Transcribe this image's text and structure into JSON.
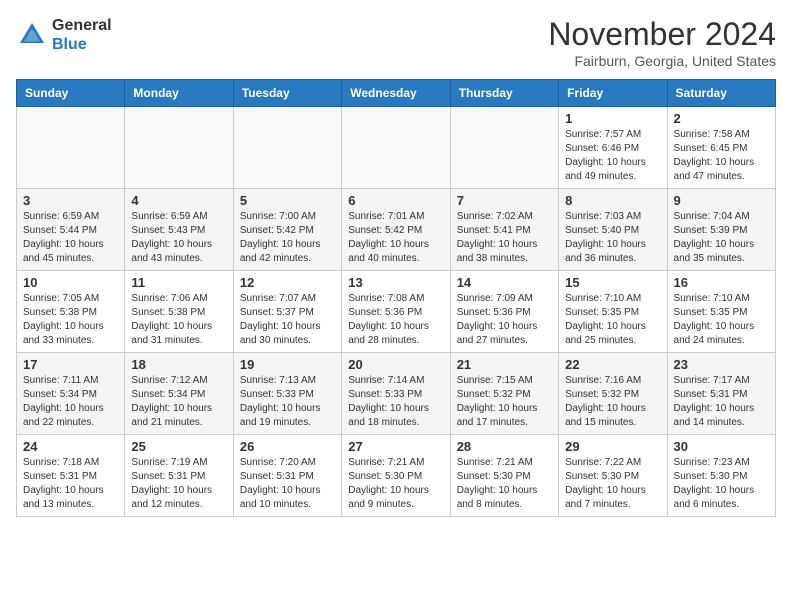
{
  "header": {
    "logo_line1": "General",
    "logo_line2": "Blue",
    "month_title": "November 2024",
    "location": "Fairburn, Georgia, United States"
  },
  "calendar": {
    "weekdays": [
      "Sunday",
      "Monday",
      "Tuesday",
      "Wednesday",
      "Thursday",
      "Friday",
      "Saturday"
    ],
    "weeks": [
      [
        {
          "day": "",
          "info": ""
        },
        {
          "day": "",
          "info": ""
        },
        {
          "day": "",
          "info": ""
        },
        {
          "day": "",
          "info": ""
        },
        {
          "day": "",
          "info": ""
        },
        {
          "day": "1",
          "info": "Sunrise: 7:57 AM\nSunset: 6:46 PM\nDaylight: 10 hours and 49 minutes."
        },
        {
          "day": "2",
          "info": "Sunrise: 7:58 AM\nSunset: 6:45 PM\nDaylight: 10 hours and 47 minutes."
        }
      ],
      [
        {
          "day": "3",
          "info": "Sunrise: 6:59 AM\nSunset: 5:44 PM\nDaylight: 10 hours and 45 minutes."
        },
        {
          "day": "4",
          "info": "Sunrise: 6:59 AM\nSunset: 5:43 PM\nDaylight: 10 hours and 43 minutes."
        },
        {
          "day": "5",
          "info": "Sunrise: 7:00 AM\nSunset: 5:42 PM\nDaylight: 10 hours and 42 minutes."
        },
        {
          "day": "6",
          "info": "Sunrise: 7:01 AM\nSunset: 5:42 PM\nDaylight: 10 hours and 40 minutes."
        },
        {
          "day": "7",
          "info": "Sunrise: 7:02 AM\nSunset: 5:41 PM\nDaylight: 10 hours and 38 minutes."
        },
        {
          "day": "8",
          "info": "Sunrise: 7:03 AM\nSunset: 5:40 PM\nDaylight: 10 hours and 36 minutes."
        },
        {
          "day": "9",
          "info": "Sunrise: 7:04 AM\nSunset: 5:39 PM\nDaylight: 10 hours and 35 minutes."
        }
      ],
      [
        {
          "day": "10",
          "info": "Sunrise: 7:05 AM\nSunset: 5:38 PM\nDaylight: 10 hours and 33 minutes."
        },
        {
          "day": "11",
          "info": "Sunrise: 7:06 AM\nSunset: 5:38 PM\nDaylight: 10 hours and 31 minutes."
        },
        {
          "day": "12",
          "info": "Sunrise: 7:07 AM\nSunset: 5:37 PM\nDaylight: 10 hours and 30 minutes."
        },
        {
          "day": "13",
          "info": "Sunrise: 7:08 AM\nSunset: 5:36 PM\nDaylight: 10 hours and 28 minutes."
        },
        {
          "day": "14",
          "info": "Sunrise: 7:09 AM\nSunset: 5:36 PM\nDaylight: 10 hours and 27 minutes."
        },
        {
          "day": "15",
          "info": "Sunrise: 7:10 AM\nSunset: 5:35 PM\nDaylight: 10 hours and 25 minutes."
        },
        {
          "day": "16",
          "info": "Sunrise: 7:10 AM\nSunset: 5:35 PM\nDaylight: 10 hours and 24 minutes."
        }
      ],
      [
        {
          "day": "17",
          "info": "Sunrise: 7:11 AM\nSunset: 5:34 PM\nDaylight: 10 hours and 22 minutes."
        },
        {
          "day": "18",
          "info": "Sunrise: 7:12 AM\nSunset: 5:34 PM\nDaylight: 10 hours and 21 minutes."
        },
        {
          "day": "19",
          "info": "Sunrise: 7:13 AM\nSunset: 5:33 PM\nDaylight: 10 hours and 19 minutes."
        },
        {
          "day": "20",
          "info": "Sunrise: 7:14 AM\nSunset: 5:33 PM\nDaylight: 10 hours and 18 minutes."
        },
        {
          "day": "21",
          "info": "Sunrise: 7:15 AM\nSunset: 5:32 PM\nDaylight: 10 hours and 17 minutes."
        },
        {
          "day": "22",
          "info": "Sunrise: 7:16 AM\nSunset: 5:32 PM\nDaylight: 10 hours and 15 minutes."
        },
        {
          "day": "23",
          "info": "Sunrise: 7:17 AM\nSunset: 5:31 PM\nDaylight: 10 hours and 14 minutes."
        }
      ],
      [
        {
          "day": "24",
          "info": "Sunrise: 7:18 AM\nSunset: 5:31 PM\nDaylight: 10 hours and 13 minutes."
        },
        {
          "day": "25",
          "info": "Sunrise: 7:19 AM\nSunset: 5:31 PM\nDaylight: 10 hours and 12 minutes."
        },
        {
          "day": "26",
          "info": "Sunrise: 7:20 AM\nSunset: 5:31 PM\nDaylight: 10 hours and 10 minutes."
        },
        {
          "day": "27",
          "info": "Sunrise: 7:21 AM\nSunset: 5:30 PM\nDaylight: 10 hours and 9 minutes."
        },
        {
          "day": "28",
          "info": "Sunrise: 7:21 AM\nSunset: 5:30 PM\nDaylight: 10 hours and 8 minutes."
        },
        {
          "day": "29",
          "info": "Sunrise: 7:22 AM\nSunset: 5:30 PM\nDaylight: 10 hours and 7 minutes."
        },
        {
          "day": "30",
          "info": "Sunrise: 7:23 AM\nSunset: 5:30 PM\nDaylight: 10 hours and 6 minutes."
        }
      ]
    ]
  }
}
